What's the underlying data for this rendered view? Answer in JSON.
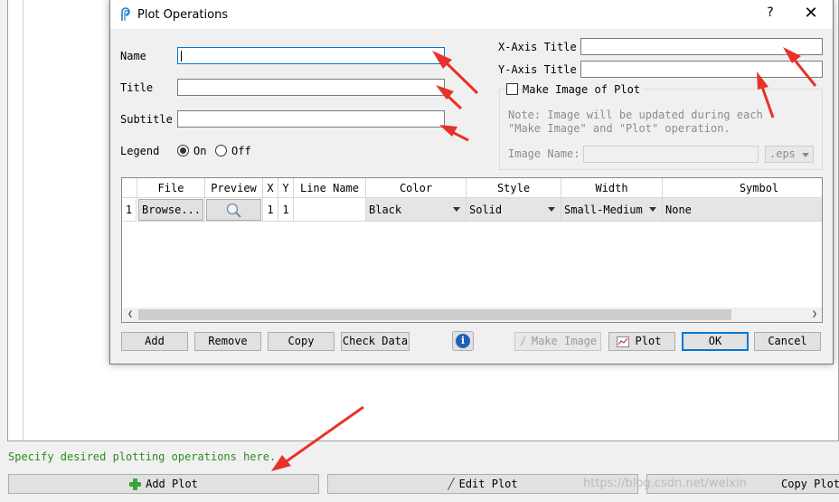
{
  "background": {
    "status_text": "Specify desired plotting operations here.",
    "add_plot_label": "Add Plot",
    "edit_plot_label": "Edit Plot",
    "copy_plot_label": "Copy Plot",
    "watermark": "https://blog.csdn.net/weixin"
  },
  "dialog": {
    "title": "Plot Operations",
    "help_label": "?",
    "close_label": "✕",
    "fields": {
      "name_label": "Name",
      "name_value": "",
      "title_label": "Title",
      "title_value": "",
      "subtitle_label": "Subtitle",
      "subtitle_value": "",
      "legend_label": "Legend",
      "legend_on": "On",
      "legend_off": "Off",
      "legend_selected": "On",
      "xaxis_label": "X-Axis Title",
      "xaxis_value": "",
      "yaxis_label": "Y-Axis Title",
      "yaxis_value": ""
    },
    "image": {
      "make_image_label": "Make Image of Plot",
      "note_line1": "Note: Image will be updated during each",
      "note_line2": "\"Make Image\" and \"Plot\" operation.",
      "image_name_label": "Image Name:",
      "image_name_value": "",
      "format_value": ".eps"
    },
    "table": {
      "headers": [
        "File",
        "Preview",
        "X",
        "Y",
        "Line Name",
        "Color",
        "Style",
        "Width",
        "Symbol"
      ],
      "rows": [
        {
          "index": "1",
          "file": "Browse...",
          "x": "1",
          "y": "1",
          "line_name": "",
          "color": "Black",
          "style": "Solid",
          "width": "Small-Medium",
          "symbol": "None"
        }
      ]
    },
    "buttons": {
      "add": "Add",
      "remove": "Remove",
      "copy": "Copy",
      "check_data": "Check Data",
      "make_image": "Make Image",
      "plot": "Plot",
      "ok": "OK",
      "cancel": "Cancel"
    },
    "colors": {
      "focus_blue": "#0078d7",
      "arrow_red": "#e8312a",
      "status_green": "#2e8b22"
    }
  }
}
